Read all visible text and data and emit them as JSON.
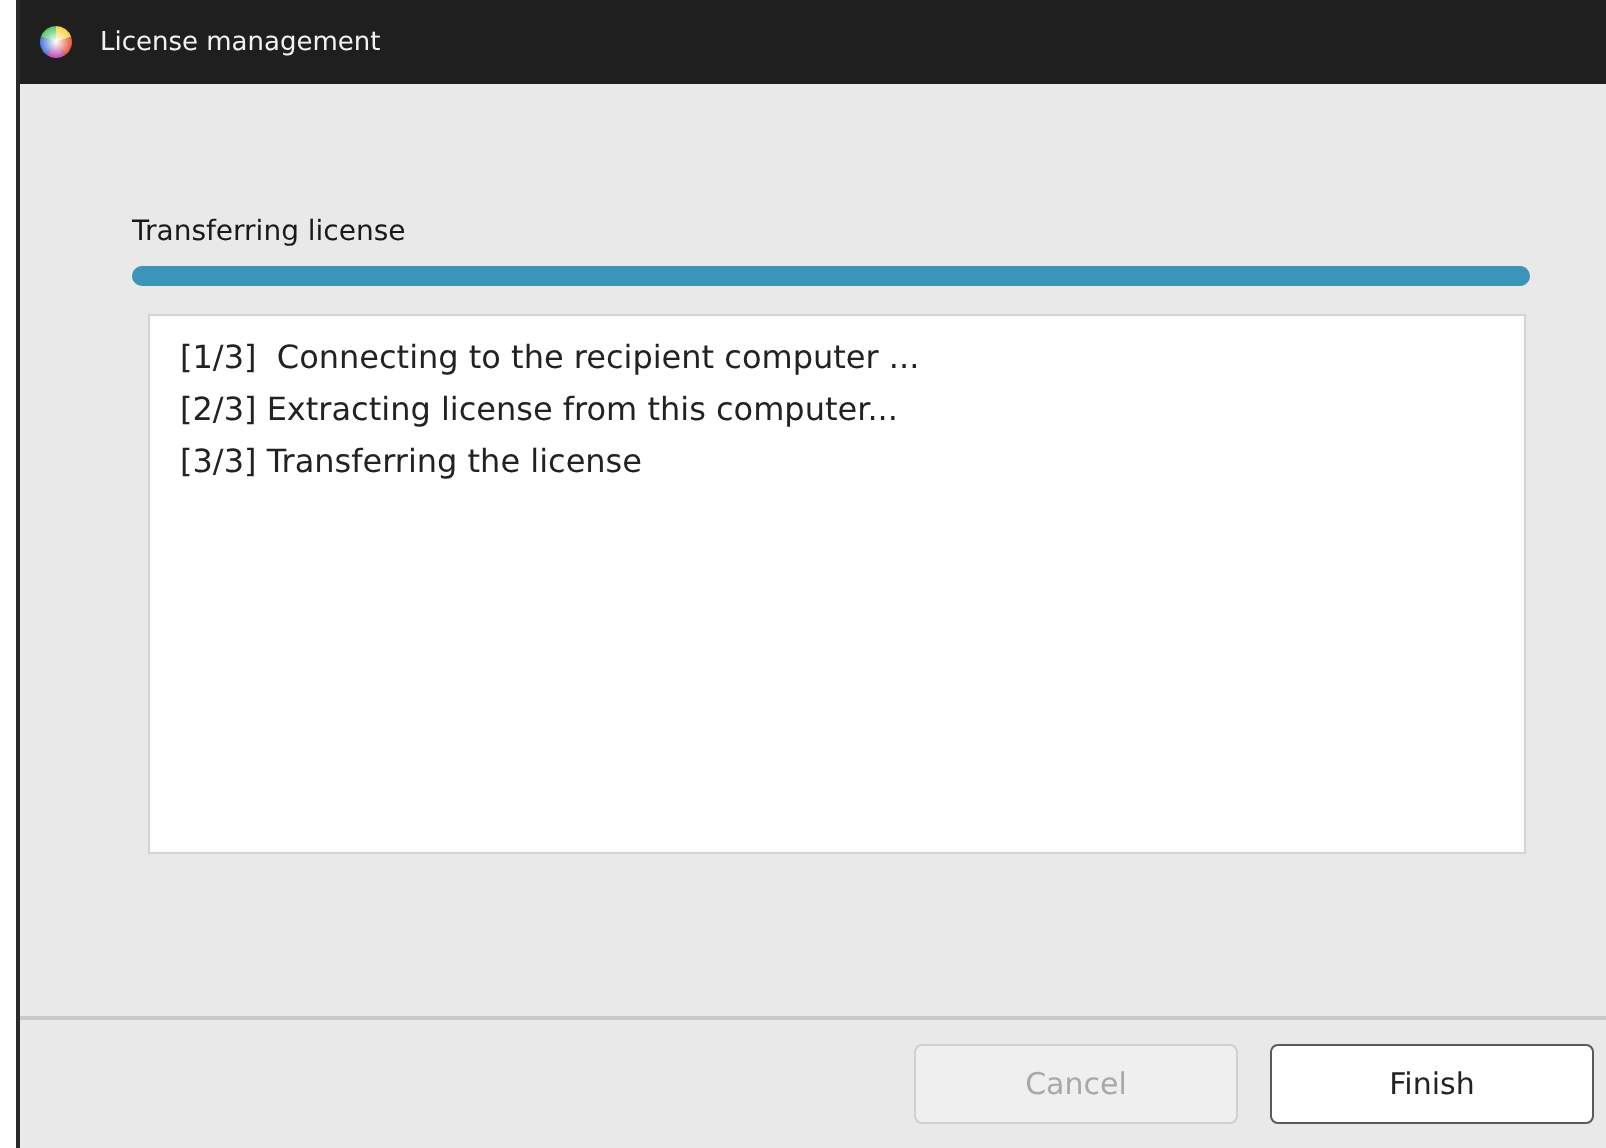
{
  "window": {
    "title": "License management"
  },
  "progress": {
    "label": "Transferring license",
    "level": 1
  },
  "log": [
    "[1/3]  Connecting to the recipient computer ...",
    "[2/3] Extracting license from this computer...",
    "[3/3] Transferring the license"
  ],
  "buttons": [
    {
      "label": "Cancel",
      "disabled": true,
      "default": false
    },
    {
      "label": "Finish",
      "disabled": false,
      "default": true
    }
  ]
}
